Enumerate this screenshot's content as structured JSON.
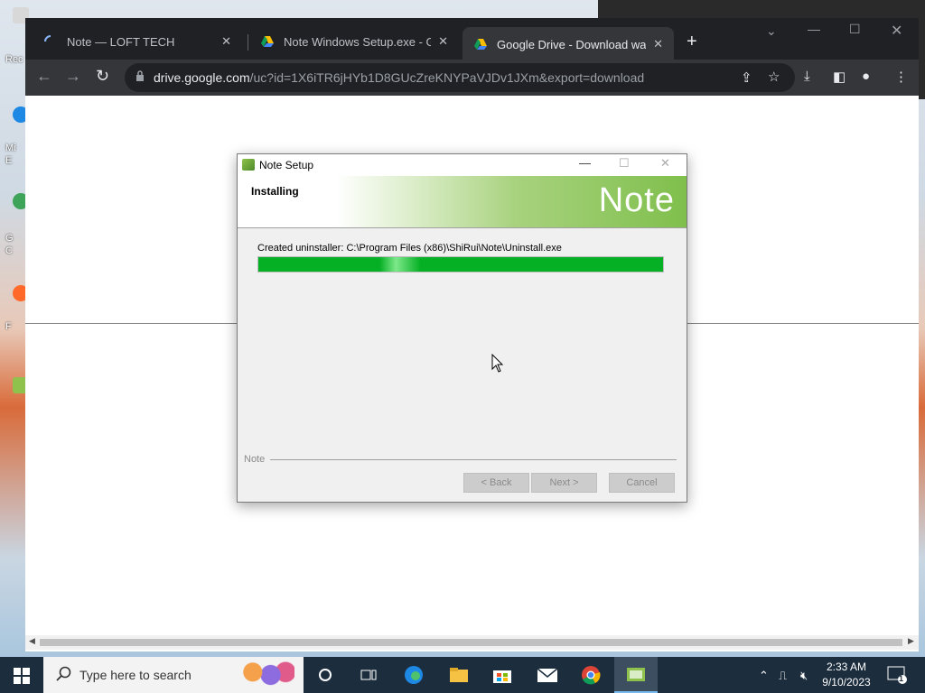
{
  "desktop": {
    "labels": [
      "Rec",
      "Mi",
      "E",
      "G",
      "C",
      "F"
    ]
  },
  "browser": {
    "tabs": [
      {
        "title": "Note — LOFT TECH",
        "active": false
      },
      {
        "title": "Note Windows Setup.exe - Goog",
        "active": false
      },
      {
        "title": "Google Drive - Download warnin",
        "active": true
      }
    ],
    "new_tab_label": "+",
    "address": {
      "host": "drive.google.com",
      "path": "/uc?id=1X6iTR6jHYb1D8GUcZreKNYPaVJDv1JXm&export=download"
    }
  },
  "dialog": {
    "title": "Note Setup",
    "header_title": "Installing",
    "brand": "Note",
    "status_text": "Created uninstaller: C:\\Program Files (x86)\\ShiRui\\Note\\Uninstall.exe",
    "progress": 1.0,
    "footer_brand": "Note",
    "buttons": {
      "back": "< Back",
      "next": "Next >",
      "cancel": "Cancel"
    }
  },
  "taskbar": {
    "search_placeholder": "Type here to search",
    "apps": [
      "task-view-icon",
      "edge-icon",
      "file-explorer-icon",
      "store-icon",
      "mail-icon",
      "chrome-icon",
      "note-setup-icon"
    ],
    "clock": {
      "time": "2:33 AM",
      "date": "9/10/2023"
    },
    "notification_count": "1"
  },
  "colors": {
    "progress_green": "#06b025",
    "brand_green": "#7fbf4c",
    "taskbar": "#1c2d3e",
    "chrome_dark": "#202124"
  }
}
